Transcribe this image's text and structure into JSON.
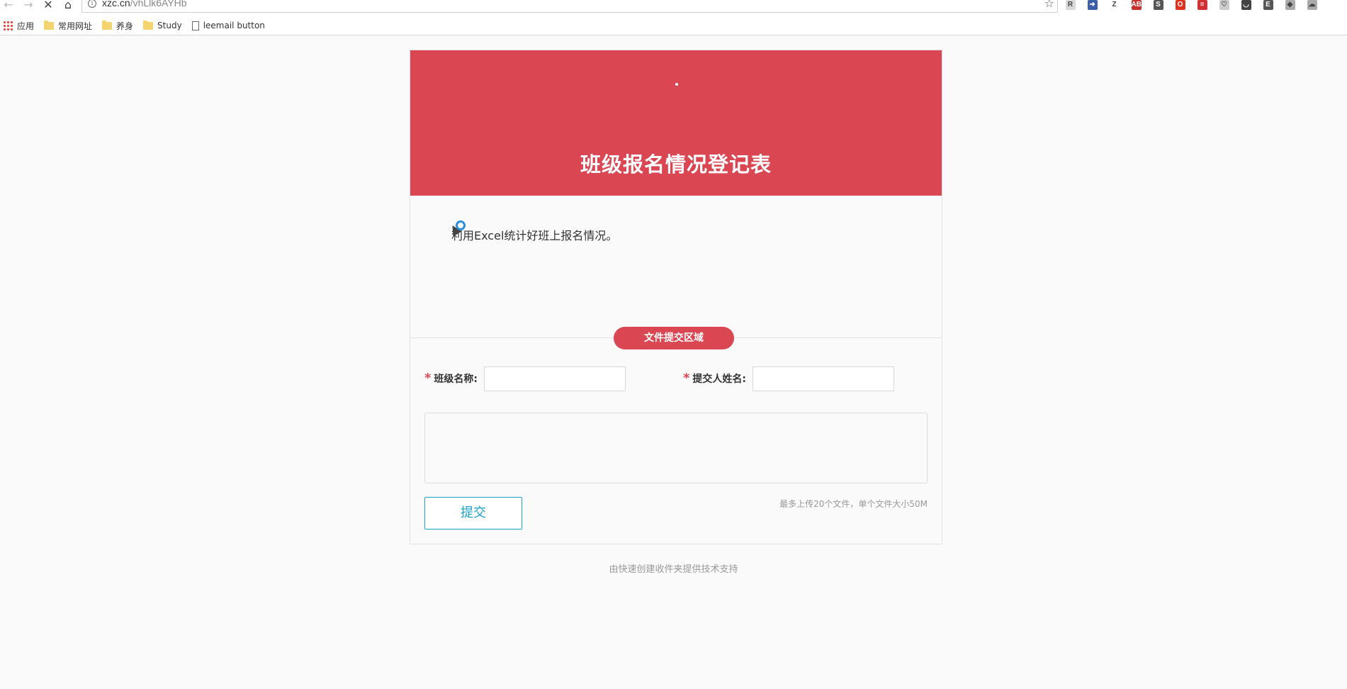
{
  "browser": {
    "url_host": "xzc.cn",
    "url_path": "/vhLlk6AYHb",
    "bookmarks": [
      {
        "label": "应用",
        "icon": "apps-grid-icon"
      },
      {
        "label": "常用网址",
        "icon": "folder-icon"
      },
      {
        "label": "养身",
        "icon": "folder-icon"
      },
      {
        "label": "Study",
        "icon": "folder-icon"
      },
      {
        "label": "leemail button",
        "icon": "page-icon"
      }
    ],
    "extensions": [
      {
        "name": "r-extension-icon",
        "text": "R",
        "color": "#d9d9d9"
      },
      {
        "name": "arrow-extension-icon",
        "text": "➜",
        "color": "#3b5ea8"
      },
      {
        "name": "z-extension-icon",
        "text": "Z",
        "color": "#ffffff"
      },
      {
        "name": "adblock-plus-icon",
        "text": "ABP",
        "color": "#c9302c"
      },
      {
        "name": "s-extension-icon",
        "text": "S",
        "color": "#555555"
      },
      {
        "name": "opera-icon",
        "text": "O",
        "color": "#e0301e"
      },
      {
        "name": "notes-extension-icon",
        "text": "≡",
        "color": "#d03030"
      },
      {
        "name": "shield-extension-icon",
        "text": "♡",
        "color": "#cccccc"
      },
      {
        "name": "pocket-icon",
        "text": "◡",
        "color": "#444444"
      },
      {
        "name": "evernote-icon",
        "text": "E",
        "color": "#555555"
      },
      {
        "name": "box-extension-icon",
        "text": "◆",
        "color": "#aaaaaa"
      },
      {
        "name": "cloud-extension-icon",
        "text": "☁",
        "color": "#aaaaaa"
      }
    ]
  },
  "form": {
    "title": "班级报名情况登记表",
    "description": "利用Excel统计好班上报名情况。",
    "section_label": "文件提交区域",
    "fields": [
      {
        "label": "班级名称:",
        "value": ""
      },
      {
        "label": "提交人姓名:",
        "value": ""
      }
    ],
    "required_mark": "*",
    "submit_label": "提交",
    "limit_note": "最多上传20个文件，单个文件大小50M"
  },
  "footer": {
    "text": "由快速创建收件夹提供技术支持"
  },
  "colors": {
    "accent_red": "#da4651",
    "submit_blue": "#1aa3c8"
  }
}
